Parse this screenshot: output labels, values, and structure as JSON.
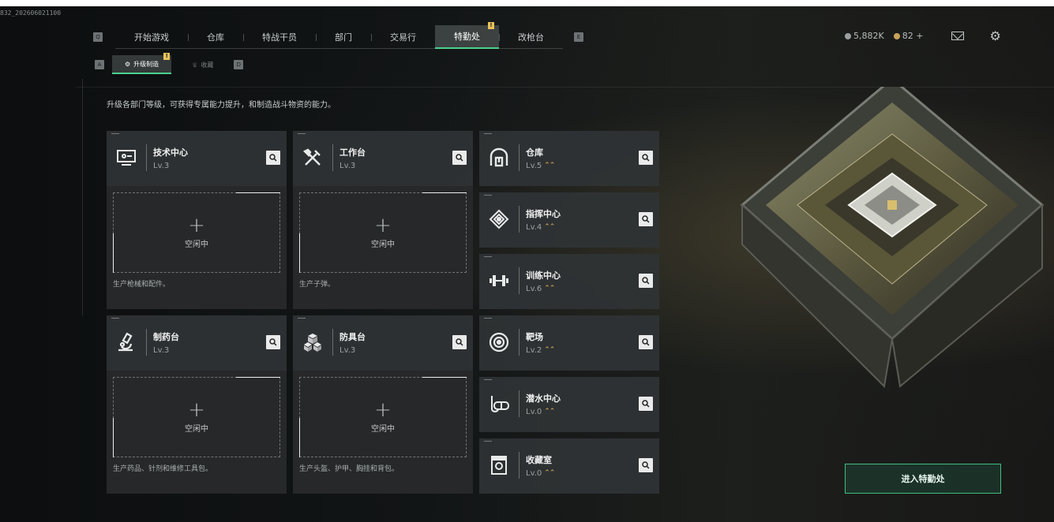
{
  "build_id": "832_202606021100",
  "nav": {
    "key_left": "Q",
    "key_right": "E",
    "tabs": [
      "开始游戏",
      "仓库",
      "特战干员",
      "部门",
      "交易行",
      "特勤处",
      "改枪台"
    ],
    "active_index": 5,
    "badge": "!"
  },
  "subnav": {
    "key_left": "A",
    "key_right": "D",
    "tabs": [
      "升级制造",
      "收藏"
    ],
    "active_index": 0,
    "badge": "!"
  },
  "description": "升级各部门等级，可获得专属能力提升，和制造战斗物资的能力。",
  "big_cards": [
    {
      "title": "技术中心",
      "level": "Lv.3",
      "slot": "空闲中",
      "plus": "+",
      "desc": "生产枪械和配件。",
      "icon": "monitor-icon"
    },
    {
      "title": "工作台",
      "level": "Lv.3",
      "slot": "空闲中",
      "plus": "+",
      "desc": "生产子弹。",
      "icon": "tools-icon"
    },
    {
      "title": "制药台",
      "level": "Lv.3",
      "slot": "空闲中",
      "plus": "+",
      "desc": "生产药品、针剂和维修工具包。",
      "icon": "microscope-icon"
    },
    {
      "title": "防具台",
      "level": "Lv.3",
      "slot": "空闲中",
      "plus": "+",
      "desc": "生产头盔、护甲、胸挂和背包。",
      "icon": "cubes-icon"
    }
  ],
  "small_cards": [
    {
      "title": "仓库",
      "level": "Lv.5",
      "upgrade": "⌃⌃",
      "icon": "warehouse-icon"
    },
    {
      "title": "指挥中心",
      "level": "Lv.4",
      "upgrade": "⌃⌃",
      "icon": "chip-icon"
    },
    {
      "title": "训练中心",
      "level": "Lv.6",
      "upgrade": "⌃⌃",
      "icon": "dumbbell-icon"
    },
    {
      "title": "靶场",
      "level": "Lv.2",
      "upgrade": "⌃⌃",
      "icon": "target-icon"
    },
    {
      "title": "潜水中心",
      "level": "Lv.0",
      "upgrade": "⌃⌃",
      "icon": "diving-mask-icon"
    },
    {
      "title": "收藏室",
      "level": "Lv.0",
      "upgrade": "⌃⌃",
      "icon": "display-case-icon"
    }
  ],
  "currency": {
    "coins": "5,882K",
    "premium": "82 +"
  },
  "enter_button": "进入特勤处",
  "colors": {
    "accent": "#4ad18f",
    "badge": "#e8c25a",
    "upgrade": "#e3b55a"
  }
}
